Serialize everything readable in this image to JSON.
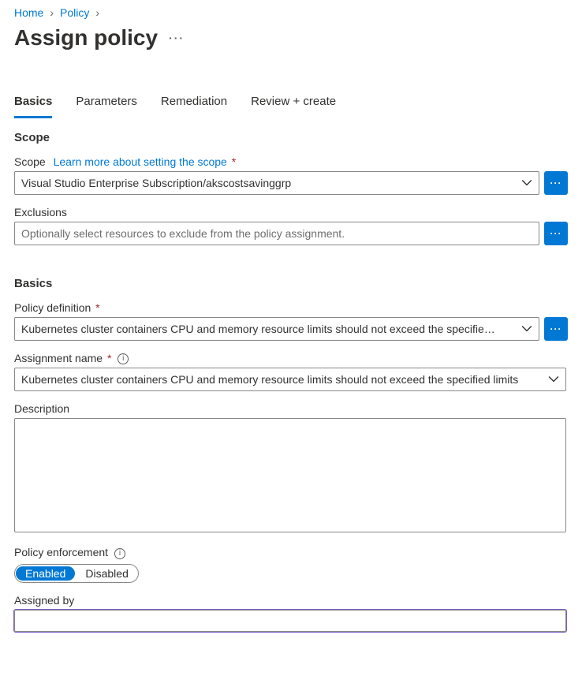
{
  "breadcrumb": {
    "home": "Home",
    "policy": "Policy"
  },
  "title": "Assign policy",
  "tabs": {
    "basics": "Basics",
    "parameters": "Parameters",
    "remediation": "Remediation",
    "review": "Review + create"
  },
  "scope": {
    "heading": "Scope",
    "label": "Scope",
    "learn": "Learn more about setting the scope",
    "value": "Visual Studio Enterprise Subscription/akscostsavinggrp",
    "exclusions_label": "Exclusions",
    "exclusions_placeholder": "Optionally select resources to exclude from the policy assignment."
  },
  "basics": {
    "heading": "Basics",
    "policy_def_label": "Policy definition",
    "policy_def_value": "Kubernetes cluster containers CPU and memory resource limits should not exceed the specifie…",
    "assign_name_label": "Assignment name",
    "assign_name_value": "Kubernetes cluster containers CPU and memory resource limits should not exceed the specified limits",
    "description_label": "Description",
    "description_value": "",
    "enforcement_label": "Policy enforcement",
    "enabled": "Enabled",
    "disabled": "Disabled",
    "assigned_by_label": "Assigned by",
    "assigned_by_value": ""
  },
  "glyphs": {
    "ellipsis": "···",
    "info": "i"
  }
}
